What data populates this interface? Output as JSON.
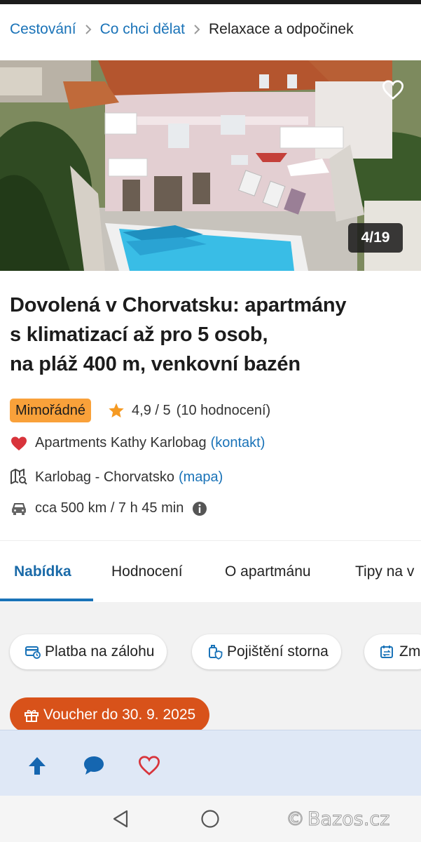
{
  "breadcrumb": {
    "items": [
      "Cestování",
      "Co chci dělat"
    ],
    "current": "Relaxace a odpočinek"
  },
  "gallery": {
    "counter": "4/19"
  },
  "listing": {
    "title_lines": [
      "Dovolená v Chorvatsku: apartmány",
      "s klimatizací až pro 5 osob,",
      "na pláž 400 m, venkovní bazén"
    ],
    "badge": "Mimořádné",
    "rating": "4,9 / 5",
    "rating_count": "(10 hodnocení)",
    "provider": "Apartments Kathy Karlobag",
    "provider_link": "(kontakt)",
    "location": "Karlobag - Chorvatsko",
    "location_link": "(mapa)",
    "distance": "cca 500 km / 7 h 45 min"
  },
  "tabs": [
    "Nabídka",
    "Hodnocení",
    "O apartmánu",
    "Tipy na v"
  ],
  "chips": [
    "Platba na zálohu",
    "Pojištění storna",
    "Zm"
  ],
  "voucher": "Voucher do 30. 9. 2025",
  "watermark": {
    "symbol": "©",
    "text": "Bazos.cz"
  },
  "colors": {
    "link": "#1a73b8",
    "badge": "#f9a13a",
    "voucher": "#d8521a",
    "heart": "#d8343b",
    "star": "#f59a23"
  }
}
